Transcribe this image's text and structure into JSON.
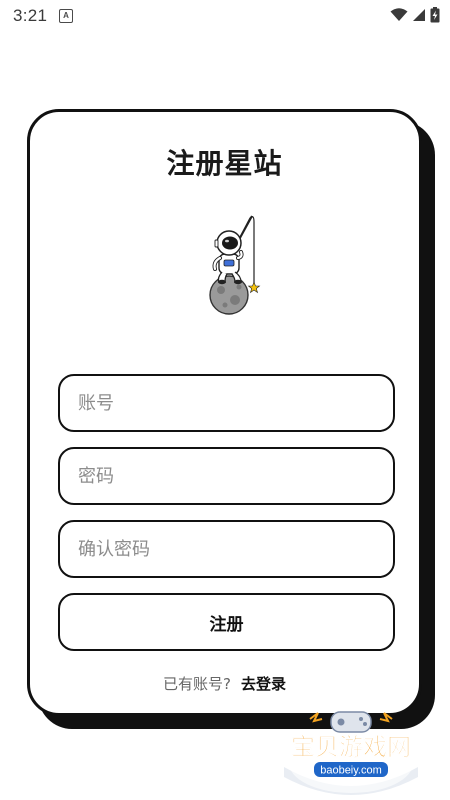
{
  "status_bar": {
    "time": "3:21",
    "notification_icon": "a-badge-icon",
    "icons": [
      "wifi-icon",
      "signal-icon",
      "battery-charging-icon"
    ]
  },
  "card": {
    "title": "注册星站",
    "illustration": "astronaut-fishing-on-moon"
  },
  "form": {
    "account_placeholder": "账号",
    "password_placeholder": "密码",
    "confirm_password_placeholder": "确认密码",
    "account_value": "",
    "password_value": "",
    "confirm_password_value": "",
    "register_label": "注册"
  },
  "footer": {
    "prompt": "已有账号?",
    "login_link": "去登录"
  },
  "watermark": {
    "text": "宝贝游戏网",
    "domain": "baobeiy.com"
  },
  "colors": {
    "border": "#111111",
    "background": "#ffffff",
    "placeholder": "#8c8c8c",
    "watermark_orange": "#f29a1c"
  }
}
